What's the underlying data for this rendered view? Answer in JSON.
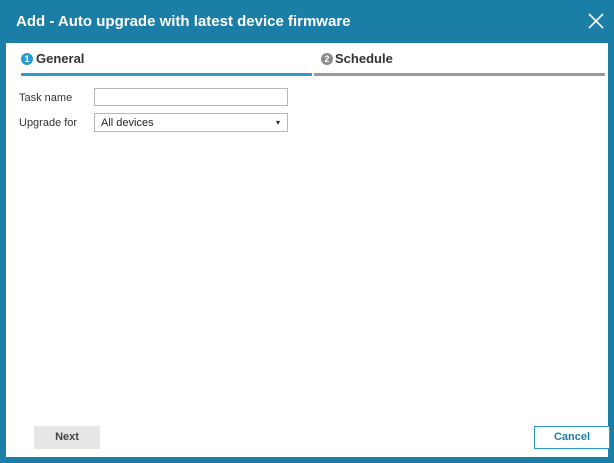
{
  "dialog": {
    "title": "Add - Auto upgrade with latest device firmware",
    "close_icon": "close-icon"
  },
  "tabs": [
    {
      "number": "1",
      "label": "General",
      "active": true,
      "color": "#2a9ad0"
    },
    {
      "number": "2",
      "label": "Schedule",
      "active": false,
      "color": "#9a9a9a"
    }
  ],
  "form": {
    "task_name": {
      "label": "Task name",
      "value": ""
    },
    "upgrade_for": {
      "label": "Upgrade for",
      "value": "All devices",
      "arrow": "▾"
    }
  },
  "buttons": {
    "next": "Next",
    "cancel": "Cancel"
  },
  "colors": {
    "titlebar": "#1a7ea6",
    "accent": "#2a9ad0"
  }
}
